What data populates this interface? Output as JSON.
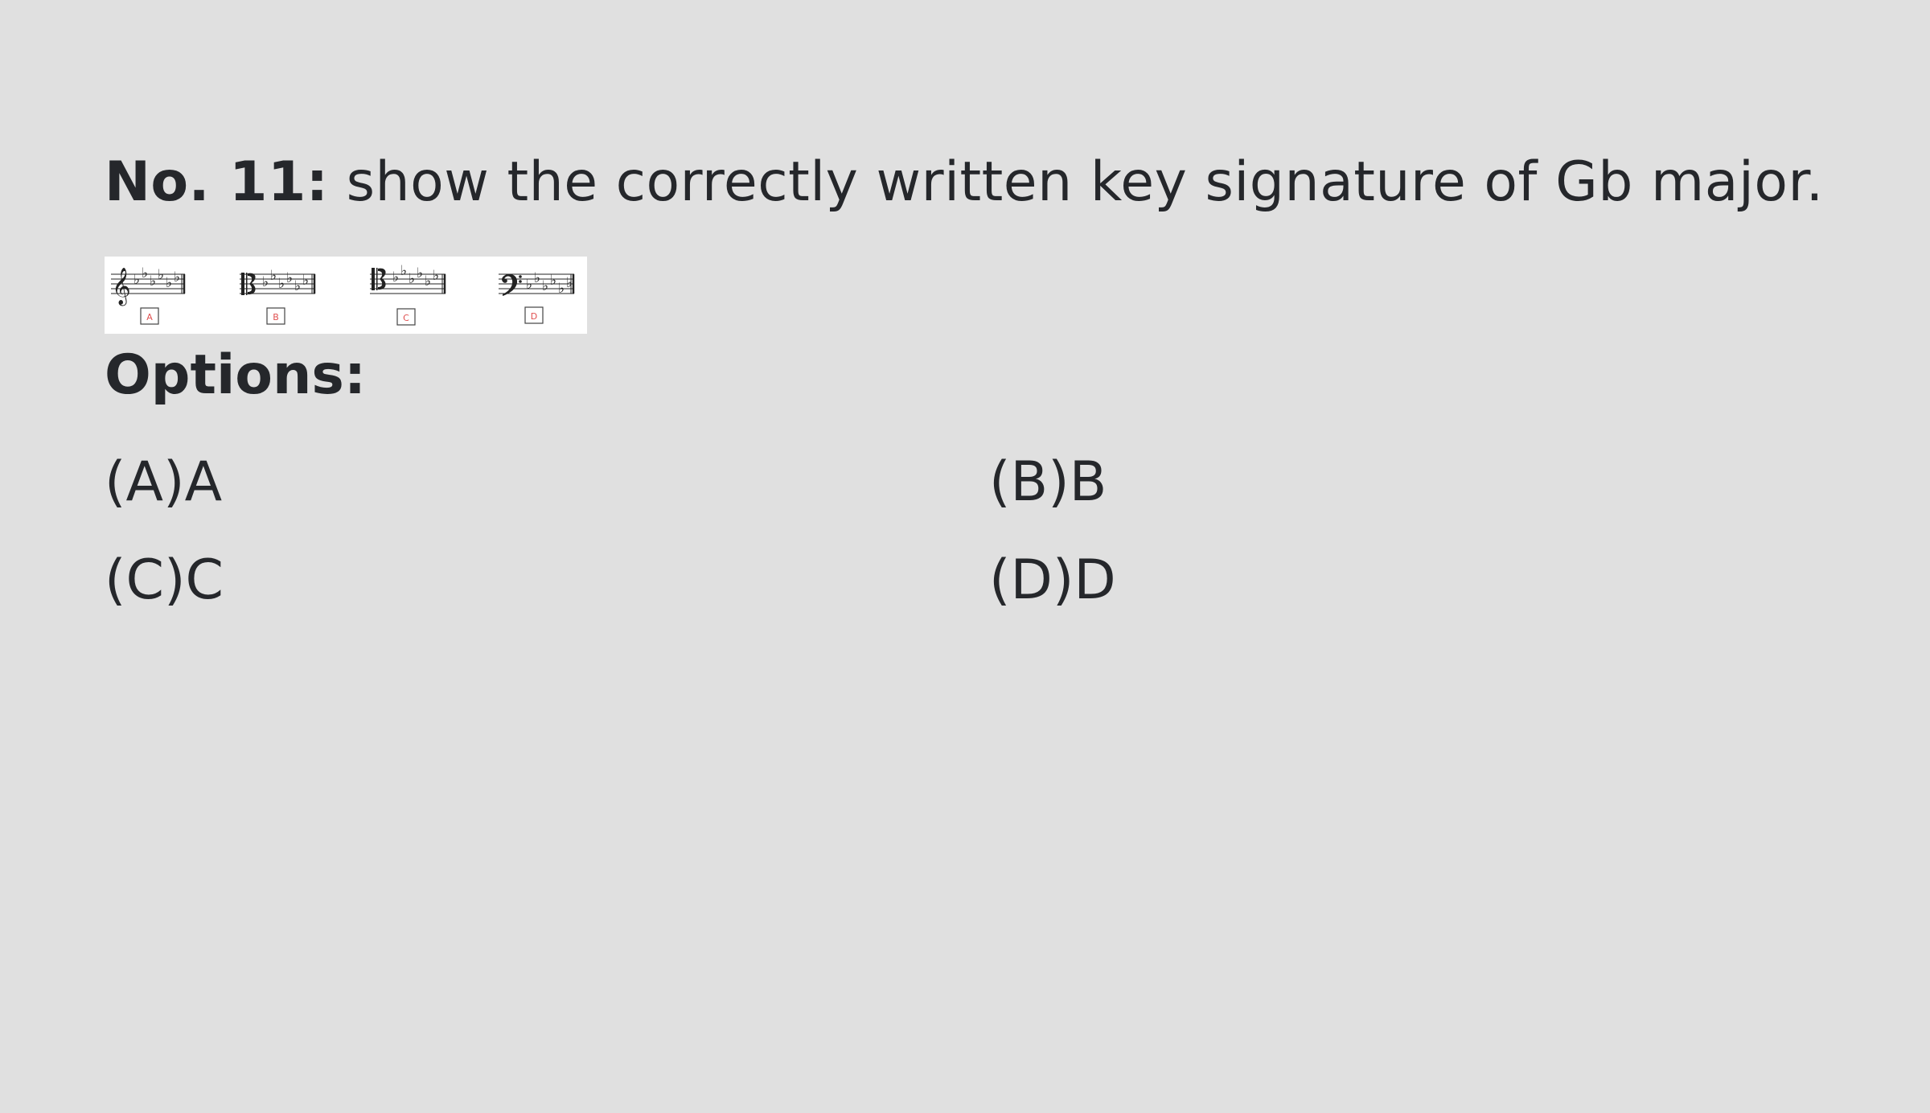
{
  "question": {
    "number_label": "No. 11:",
    "text": " show the correctly written key signature of Gb major."
  },
  "figure": {
    "staves": [
      {
        "clef": "treble",
        "box_label": "A"
      },
      {
        "clef": "alto",
        "box_label": "B"
      },
      {
        "clef": "tenor",
        "box_label": "C"
      },
      {
        "clef": "bass",
        "box_label": "D"
      }
    ]
  },
  "options": {
    "title": "Options:",
    "items": [
      {
        "key": "A",
        "label": "(A)A"
      },
      {
        "key": "B",
        "label": "(B)B"
      },
      {
        "key": "C",
        "label": "(C)C"
      },
      {
        "key": "D",
        "label": "(D)D"
      }
    ]
  },
  "colors": {
    "background": "#e0e0e0",
    "text": "#25272b",
    "box_label": "#e05050"
  }
}
